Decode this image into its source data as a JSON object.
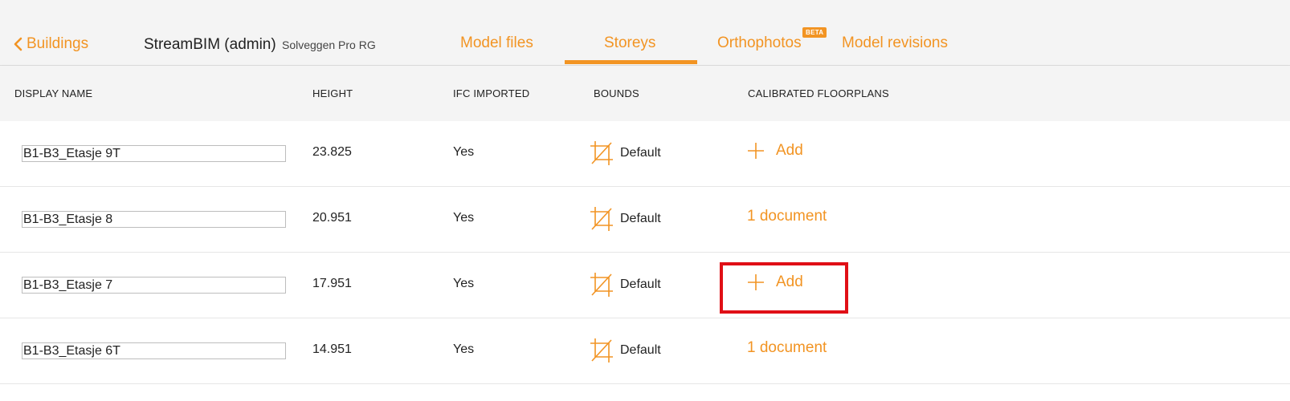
{
  "nav": {
    "back_label": "Buildings",
    "app_title": "StreamBIM (admin)",
    "project_name": "Solveggen Pro RG"
  },
  "tabs": [
    {
      "label": "Model files"
    },
    {
      "label": "Storeys",
      "active": true
    },
    {
      "label": "Orthophotos",
      "badge": "BETA"
    },
    {
      "label": "Model revisions"
    }
  ],
  "columns": {
    "display_name": "DISPLAY NAME",
    "height": "HEIGHT",
    "ifc_imported": "IFC IMPORTED",
    "bounds": "BOUNDS",
    "calibrated_floorplans": "CALIBRATED FLOORPLANS"
  },
  "rows": [
    {
      "display_name": "B1-B3_Etasje 9T",
      "height": "23.825",
      "ifc_imported": "Yes",
      "bounds": "Default",
      "floorplans": "Add",
      "floorplans_type": "add"
    },
    {
      "display_name": "B1-B3_Etasje 8",
      "height": "20.951",
      "ifc_imported": "Yes",
      "bounds": "Default",
      "floorplans": "1 document",
      "floorplans_type": "link"
    },
    {
      "display_name": "B1-B3_Etasje 7",
      "height": "17.951",
      "ifc_imported": "Yes",
      "bounds": "Default",
      "floorplans": "Add",
      "floorplans_type": "add"
    },
    {
      "display_name": "B1-B3_Etasje 6T",
      "height": "14.951",
      "ifc_imported": "Yes",
      "bounds": "Default",
      "floorplans": "1 document",
      "floorplans_type": "link"
    }
  ],
  "colors": {
    "accent": "#f29423",
    "highlight": "#e00f16",
    "header_bg": "#f4f4f4"
  },
  "icons": {
    "back": "chevron-left-icon",
    "bounds": "crop-icon",
    "add": "plus-icon"
  }
}
